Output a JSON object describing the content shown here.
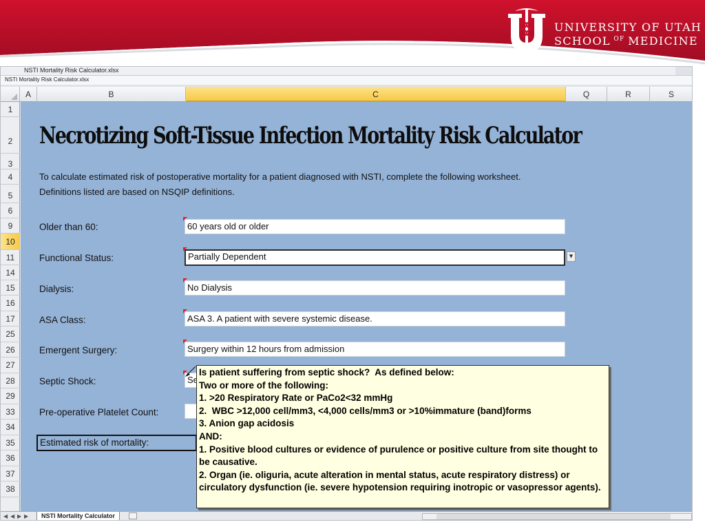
{
  "slide": {
    "logo_line1": "UNIVERSITY OF UTAH",
    "logo_line2": "SCHOOL",
    "logo_line2_small": "OF",
    "logo_line2_end": "MEDICINE",
    "logo_icon": "caduceus-block-u-icon",
    "colors": {
      "banner_red": "#c8102e",
      "banner_dark": "#a10d24"
    }
  },
  "window": {
    "back_title": "NSTI Mortality Risk Calculator.xlsx",
    "front_title": "NSTI Mortality Risk Calculator.xlsx"
  },
  "columns": [
    "A",
    "B",
    "C",
    "Q",
    "R",
    "S"
  ],
  "rows": [
    "1",
    "2",
    "3",
    "4",
    "5",
    "6",
    "9",
    "10",
    "11",
    "14",
    "15",
    "16",
    "17",
    "25",
    "26",
    "27",
    "28",
    "29",
    "33",
    "34",
    "35",
    "36",
    "37",
    "38"
  ],
  "sheet": {
    "title": "Necrotizing Soft-Tissue Infection Mortality Risk Calculator",
    "intro_line1": "To calculate estimated risk of postoperative mortality for a patient diagnosed with NSTI, complete the following worksheet.",
    "intro_line2": "Definitions listed are based on NSQIP definitions.",
    "fields": [
      {
        "label": "Older than 60:",
        "value": "60 years old or older"
      },
      {
        "label": "Functional Status:",
        "value": "Partially Dependent"
      },
      {
        "label": "Dialysis:",
        "value": "No Dialysis"
      },
      {
        "label": "ASA Class:",
        "value": "ASA 3.  A patient with severe systemic disease."
      },
      {
        "label": "Emergent Surgery:",
        "value": "Surgery within 12 hours from admission"
      },
      {
        "label": "Septic Shock:",
        "value": "Se"
      },
      {
        "label": "Pre-operative Platelet Count:",
        "value": ""
      }
    ],
    "mortality_label": "Estimated risk of mortality:",
    "selected_cell": "C10"
  },
  "comment": {
    "lines": [
      "Is patient suffering from septic shock?  As defined below:",
      "Two or more of the following:",
      "1. >20 Respiratory Rate or PaCo2<32 mmHg",
      "2.  WBC >12,000 cell/mm3, <4,000 cells/mm3 or >10%immature (band)forms",
      "3. Anion gap acidosis",
      "AND:",
      "1. Positive blood cultures or evidence of purulence or positive culture from site thought to be causative.",
      "2. Organ (ie. oliguria, acute alteration in mental status, acute respiratory distress) or circulatory dysfunction (ie. severe hypotension requiring inotropic or vasopressor agents)."
    ]
  },
  "sheet_tabs": {
    "active": "NSTI Mortality Calculator"
  }
}
